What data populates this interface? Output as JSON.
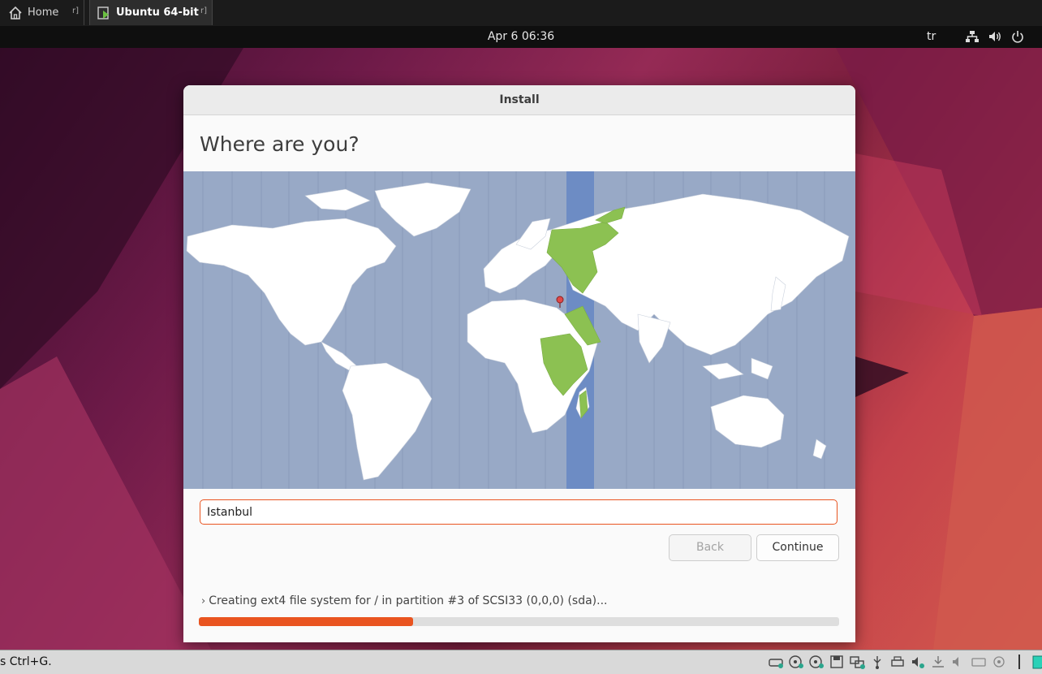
{
  "vmware": {
    "tabs": [
      {
        "label": "Home",
        "close": "r]"
      },
      {
        "label": "Ubuntu 64-bit",
        "close": "r]"
      }
    ],
    "status_text": "s Ctrl+G."
  },
  "topbar": {
    "clock": "Apr 6  06:36",
    "keyboard": "tr",
    "icons": [
      "network-icon",
      "volume-icon",
      "power-icon"
    ]
  },
  "installer": {
    "window_title": "Install",
    "heading": "Where are you?",
    "timezone_value": "Istanbul",
    "back_label": "Back",
    "continue_label": "Continue",
    "progress_text": "Creating ext4 file system for / in partition #3 of SCSI33 (0,0,0) (sda)...",
    "progress": 0.334
  },
  "colors": {
    "accent": "#e95420",
    "map_ocean": "#98a9c6",
    "map_highlight": "#8cc152"
  }
}
